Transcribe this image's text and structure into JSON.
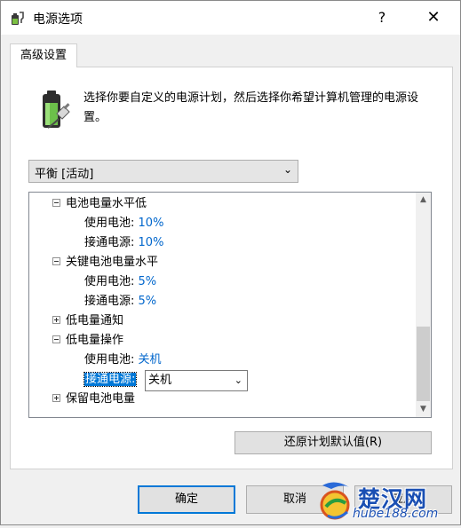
{
  "window": {
    "title": "电源选项",
    "help": "?",
    "close": "✕"
  },
  "tabs": [
    {
      "label": "高级设置"
    }
  ],
  "description": "选择你要自定义的电源计划，然后选择你希望计算机管理的电源设置。",
  "plan_select": {
    "value": "平衡 [活动]"
  },
  "tree": {
    "items": [
      {
        "label": "电池电量水平低",
        "expanded": true
      },
      {
        "label": "使用电池:",
        "value": "10%"
      },
      {
        "label": "接通电源:",
        "value": "10%"
      },
      {
        "label": "关键电池电量水平",
        "expanded": true
      },
      {
        "label": "使用电池:",
        "value": "5%"
      },
      {
        "label": "接通电源:",
        "value": "5%"
      },
      {
        "label": "低电量通知",
        "expanded": false
      },
      {
        "label": "低电量操作",
        "expanded": true
      },
      {
        "label": "使用电池:",
        "value": "关机"
      },
      {
        "label": "接通电源:",
        "value": "关机"
      },
      {
        "label": "保留电池电量",
        "expanded": false
      }
    ]
  },
  "restore_button": "还原计划默认值(R)",
  "buttons": {
    "ok": "确定",
    "cancel": "取消",
    "apply": "应用"
  },
  "watermark": {
    "brand": "楚汉网",
    "url": "hube188.com"
  },
  "colors": {
    "accent": "#0078d7",
    "value_blue": "#0066cc"
  }
}
